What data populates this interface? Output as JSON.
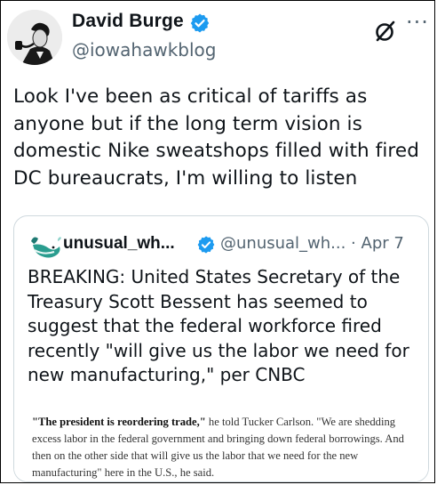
{
  "author": {
    "name": "David Burge",
    "handle": "@iowahawkblog",
    "avatar_icon": "avatar-man-with-pipe"
  },
  "actions": {
    "grok_icon": "grok-icon",
    "more_icon": "more-horizontal-icon",
    "more_glyph": "···"
  },
  "post": {
    "text": "Look I've been as critical of tariffs as\nanyone but if the long term vision is\ndomestic Nike sweatshops filled with fired\nDC bureaucrats, I'm willing to listen"
  },
  "quote": {
    "name": "unusual_wh...",
    "handle_and_date": "@unusual_wh... · Apr 7",
    "avatar_icon": "whale-icon",
    "text": "BREAKING: United States Secretary of the\nTreasury Scott Bessent has seemed to\nsuggest that the federal workforce fired\nrecently \"will give us the labor we need for\nnew manufacturing,\" per CNBC",
    "image_excerpt": {
      "bold": "\"The president is reordering trade,\"",
      "rest": " he told Tucker Carlson. \"We are shedding excess labor in the federal government and bringing down federal borrowings. And then on the other side that will give us the labor that we need for the new manufacturing\" here in the U.S., he said."
    }
  },
  "colors": {
    "verified": "#1d9bf0",
    "text": "#0f1419",
    "secondary": "#536471",
    "card_border": "#cfd9de"
  }
}
